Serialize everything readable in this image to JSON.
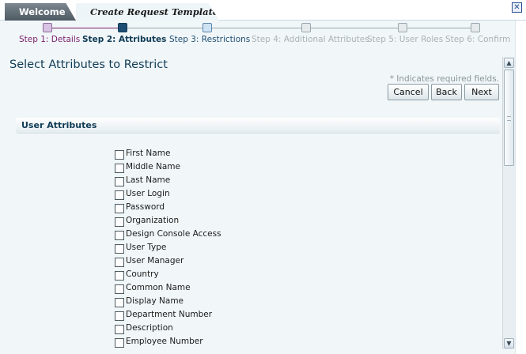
{
  "tabs": [
    {
      "label": "Welcome"
    },
    {
      "label": "Create Request Template"
    }
  ],
  "close_icon_glyph": "✕",
  "train": {
    "steps": [
      {
        "label": "Step 1: Details",
        "state": "visited",
        "color": "#7a1f6b"
      },
      {
        "label": "Step 2: Attributes",
        "state": "current",
        "color": "#0f3b55"
      },
      {
        "label": "Step 3: Restrictions",
        "state": "next",
        "color": "#1e4d74"
      },
      {
        "label": "Step 4: Additional Attributes",
        "state": "disabled",
        "color": "#a9b2b6"
      },
      {
        "label": "Step 5: User Roles",
        "state": "disabled",
        "color": "#a9b2b6"
      },
      {
        "label": "Step 6: Confirm",
        "state": "disabled",
        "color": "#a9b2b6"
      }
    ]
  },
  "page_title": "Select Attributes to Restrict",
  "required_note": "* Indicates required fields.",
  "buttons": {
    "cancel": "Cancel",
    "back": "Back",
    "next": "Next"
  },
  "section": {
    "title": "User Attributes"
  },
  "attributes": [
    {
      "label": "First Name",
      "checked": false
    },
    {
      "label": "Middle Name",
      "checked": false
    },
    {
      "label": "Last Name",
      "checked": false
    },
    {
      "label": "User Login",
      "checked": false
    },
    {
      "label": "Password",
      "checked": false
    },
    {
      "label": "Organization",
      "checked": false
    },
    {
      "label": "Design Console Access",
      "checked": false
    },
    {
      "label": "User Type",
      "checked": false
    },
    {
      "label": "User Manager",
      "checked": false
    },
    {
      "label": "Country",
      "checked": false
    },
    {
      "label": "Common Name",
      "checked": false
    },
    {
      "label": "Display Name",
      "checked": false
    },
    {
      "label": "Department Number",
      "checked": false
    },
    {
      "label": "Description",
      "checked": false
    },
    {
      "label": "Employee Number",
      "checked": false
    }
  ],
  "scrollbar": {
    "up_glyph": "▲",
    "down_glyph": "▼"
  }
}
